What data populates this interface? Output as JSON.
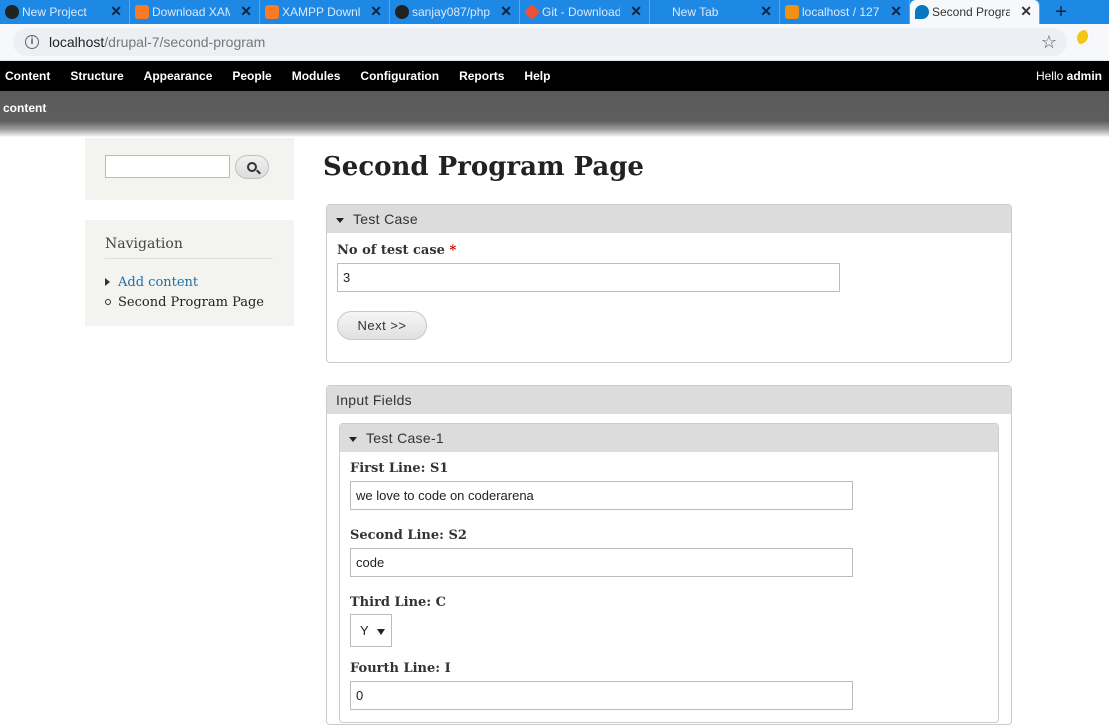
{
  "browser": {
    "tabs": [
      {
        "label": "New Project",
        "icon": "github-icon",
        "color": "#222222"
      },
      {
        "label": "Download XAMPP",
        "icon": "xampp-icon",
        "color": "#fb7a24"
      },
      {
        "label": "XAMPP Downloads",
        "icon": "xampp-icon",
        "color": "#fb7a24"
      },
      {
        "label": "sanjay087/php",
        "icon": "github-icon",
        "color": "#222222"
      },
      {
        "label": "Git - Downloads",
        "icon": "git-icon",
        "color": "#f05033"
      },
      {
        "label": "New Tab",
        "icon": "none",
        "color": ""
      },
      {
        "label": "localhost / 127",
        "icon": "phpmyadmin-icon",
        "color": "#f29111"
      },
      {
        "label": "Second Program",
        "icon": "drupal-icon",
        "color": "#0678be"
      }
    ],
    "new_tab_label": "+",
    "close_glyph": "✕",
    "url_host": "localhost",
    "url_path": "/drupal-7/second-program"
  },
  "toolbar": {
    "items": [
      "Content",
      "Structure",
      "Appearance",
      "People",
      "Modules",
      "Configuration",
      "Reports",
      "Help"
    ],
    "hello_prefix": "Hello ",
    "hello_user": "admin"
  },
  "shortcuts": {
    "link": "content"
  },
  "sidebar": {
    "search_placeholder": "",
    "nav_title": "Navigation",
    "nav_items": [
      {
        "label": "Add content",
        "link": true
      },
      {
        "label": "Second Program Page",
        "link": false
      }
    ]
  },
  "main": {
    "title": "Second Program Page",
    "test_case_fieldset": {
      "legend": "Test Case",
      "field_label": "No of test case",
      "required_mark": "*",
      "field_value": "3",
      "next_button": "Next >>"
    },
    "input_fields": {
      "legend": "Input Fields",
      "test_case_1": {
        "legend": "Test Case-1",
        "first_line_label": "First Line: S1",
        "first_line_value": "we love to code on coderarena",
        "second_line_label": "Second Line: S2",
        "second_line_value": "code",
        "third_line_label": "Third Line: C",
        "third_line_value": "Y",
        "fourth_line_label": "Fourth Line: I",
        "fourth_line_value": "0"
      }
    }
  }
}
